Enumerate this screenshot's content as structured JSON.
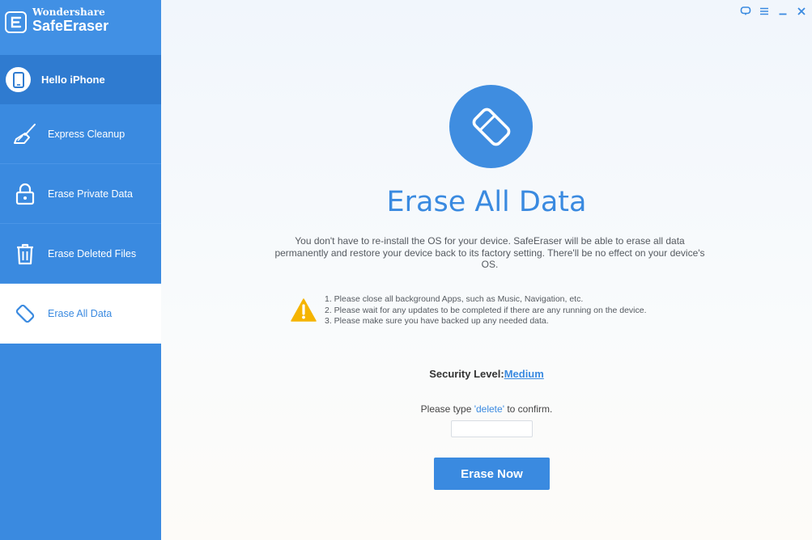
{
  "brand": {
    "company": "Wondershare",
    "product": "SafeEraser",
    "logo_letter": "E"
  },
  "device": {
    "label": "Hello iPhone",
    "icon": "phone-icon"
  },
  "sidebar": {
    "items": [
      {
        "label": "Express Cleanup",
        "icon": "broom-icon",
        "active": false
      },
      {
        "label": "Erase Private Data",
        "icon": "lock-icon",
        "active": false
      },
      {
        "label": "Erase Deleted Files",
        "icon": "trash-icon",
        "active": false
      },
      {
        "label": "Erase All Data",
        "icon": "eraser-icon",
        "active": true
      }
    ]
  },
  "window_controls": [
    "feedback-icon",
    "menu-icon",
    "minimize-icon",
    "close-icon"
  ],
  "main": {
    "title": "Erase All Data",
    "description": "You don't have to re-install the OS for your device. SafeEraser will be able to erase all data permanently  and restore your device back to its factory setting. There'll be no effect on your device's OS.",
    "warnings": [
      "1. Please close all background Apps, such as Music, Navigation, etc.",
      "2. Please wait for any updates to be completed if there are any running on the device.",
      "3. Please make sure you have backed up any needed data."
    ],
    "security_label": "Security Level:",
    "security_value": "Medium",
    "confirm_prefix": "Please type ",
    "confirm_keyword": "'delete'",
    "confirm_suffix": " to confirm.",
    "confirm_input_value": "",
    "erase_button": "Erase Now"
  },
  "colors": {
    "sidebar": "#3a8ae0",
    "accent": "#3a8ae0",
    "warning": "#f5b400"
  }
}
